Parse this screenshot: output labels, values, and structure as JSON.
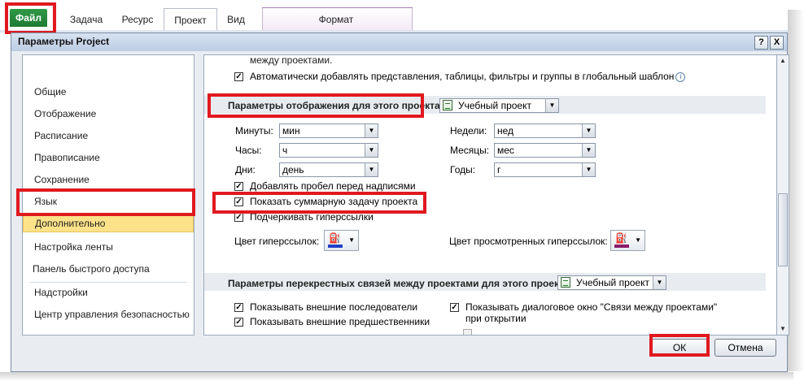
{
  "ribbon": {
    "tabs": [
      {
        "label": "Файл"
      },
      {
        "label": "Задача"
      },
      {
        "label": "Ресурс"
      },
      {
        "label": "Проект"
      },
      {
        "label": "Вид"
      },
      {
        "label": "Формат"
      }
    ]
  },
  "dialog": {
    "title": "Параметры Project",
    "help_btn": "?",
    "close_btn": "X",
    "nav": [
      {
        "label": "Общие"
      },
      {
        "label": "Отображение"
      },
      {
        "label": "Расписание"
      },
      {
        "label": "Правописание"
      },
      {
        "label": "Сохранение"
      },
      {
        "label": "Язык"
      },
      {
        "label": "Дополнительно"
      },
      {
        "label": "Настройка ленты"
      },
      {
        "label": "Панель быстрого доступа"
      },
      {
        "label": "Надстройки"
      },
      {
        "label": "Центр управления безопасностью"
      }
    ],
    "content": {
      "cut_text": "между проектами.",
      "auto_add": "Автоматически добавлять представления, таблицы, фильтры и группы в глобальный шаблон",
      "display_section": {
        "label": "Параметры отображения для этого проекта:",
        "project": "Учебный проект"
      },
      "units": {
        "minutes": {
          "label": "Минуты:",
          "value": "мин"
        },
        "hours": {
          "label": "Часы:",
          "value": "ч"
        },
        "days": {
          "label": "Дни:",
          "value": "день"
        },
        "weeks": {
          "label": "Недели:",
          "value": "нед"
        },
        "months": {
          "label": "Месяцы:",
          "value": "мес"
        },
        "years": {
          "label": "Годы:",
          "value": "г"
        }
      },
      "add_space": "Добавлять пробел перед надписями",
      "show_summary": "Показать суммарную задачу проекта",
      "underline_links": "Подчеркивать гиперссылки",
      "link_color": "Цвет гиперссылок:",
      "visited_color": "Цвет просмотренных гиперссылок:",
      "colors": {
        "link": "#1f3fc8",
        "visited": "#8a1a6a",
        "accent_red": "#e0191f",
        "selected_nav": "#fde28a"
      },
      "cross_section": {
        "label": "Параметры перекрестных связей между проектами для этого проекта:",
        "project": "Учебный проект"
      },
      "show_successors": "Показывать внешние последователи",
      "show_predecessors": "Показывать внешние предшественники",
      "show_links_dialog": "Показывать диалоговое окно \"Связи между проектами\" при открытии"
    },
    "ok_label": "ОК",
    "cancel_label": "Отмена"
  }
}
